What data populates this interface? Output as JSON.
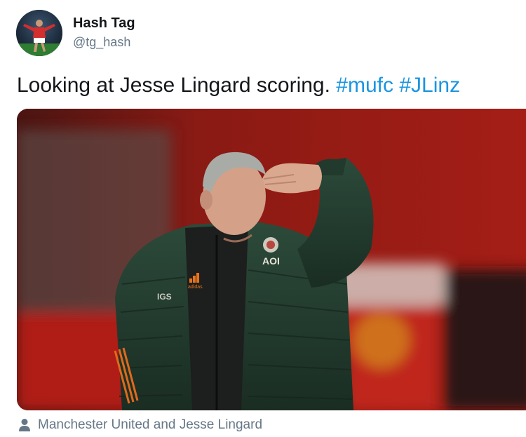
{
  "user": {
    "display_name": "Hash Tag",
    "handle": "@tg_hash",
    "avatar_icon": "player-celebrating-avatar"
  },
  "tweet": {
    "text": "Looking at Jesse Lingard scoring.",
    "hashtags": [
      "#mufc",
      "#JLinz"
    ],
    "hashtag_color": "#1b95e0"
  },
  "media": {
    "description_icon": "photo-manager-shading-eyes",
    "kit_sponsor": "AOI",
    "kit_brand": "adidas",
    "sleeve_text": "IGS"
  },
  "tagged": {
    "icon": "person-icon",
    "label": "Manchester United and Jesse Lingard"
  }
}
